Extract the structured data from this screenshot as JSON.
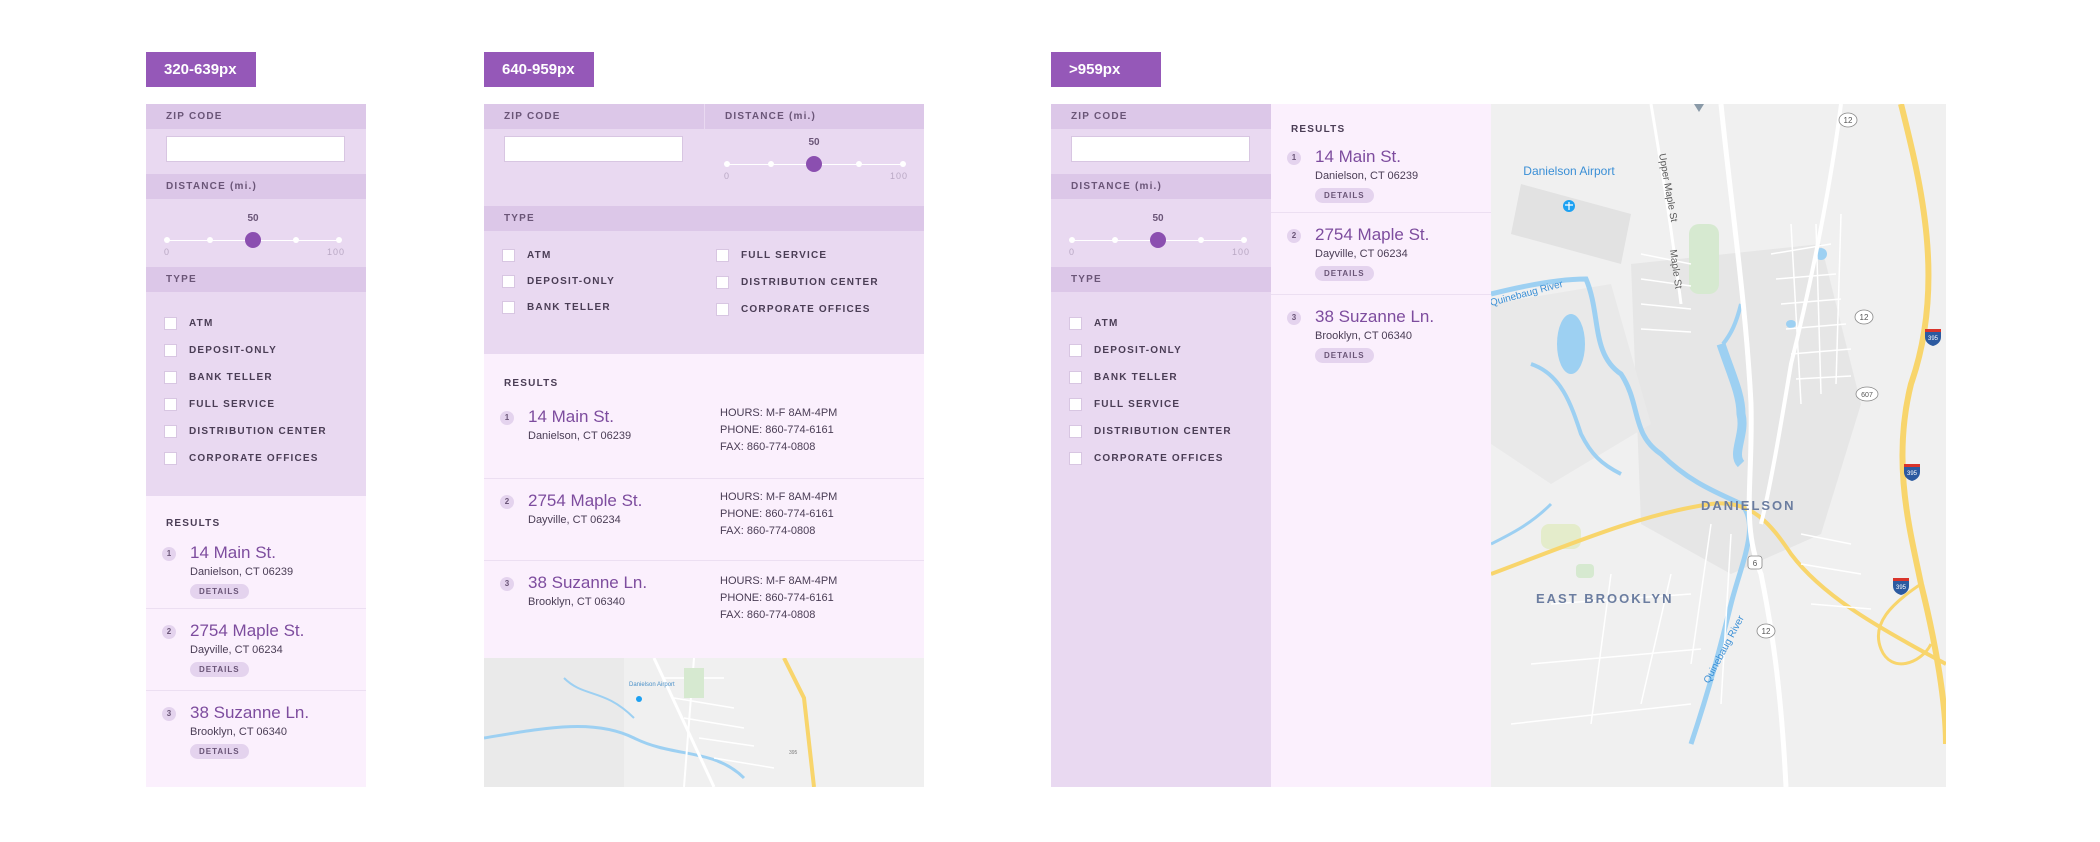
{
  "breakpoints": {
    "small": "320-639px",
    "medium": "640-959px",
    "large": ">959px"
  },
  "filters": {
    "zip_label": "ZIP CODE",
    "distance_label": "DISTANCE (mi.)",
    "distance_value": "50",
    "distance_min": "0",
    "distance_max": "100",
    "type_label": "TYPE",
    "types": [
      "ATM",
      "DEPOSIT-ONLY",
      "BANK TELLER",
      "FULL SERVICE",
      "DISTRIBUTION CENTER",
      "CORPORATE OFFICES"
    ]
  },
  "results": {
    "label": "RESULTS",
    "details_label": "DETAILS",
    "items": [
      {
        "num": "1",
        "name": "14 Main St.",
        "city": "Danielson, CT 06239",
        "hours": "HOURS: M-F 8AM-4PM",
        "phone": "PHONE: 860-774-6161",
        "fax": "FAX: 860-774-0808"
      },
      {
        "num": "2",
        "name": "2754 Maple St.",
        "city": "Dayville, CT 06234",
        "hours": "HOURS: M-F 8AM-4PM",
        "phone": "PHONE: 860-774-6161",
        "fax": "FAX: 860-774-0808"
      },
      {
        "num": "3",
        "name": "38 Suzanne Ln.",
        "city": "Brooklyn, CT 06340",
        "hours": "HOURS: M-F 8AM-4PM",
        "phone": "PHONE: 860-774-6161",
        "fax": "FAX: 860-774-0808"
      }
    ]
  },
  "map": {
    "airport": "Danielson Airport",
    "river": "Quinebaug River",
    "river_upper": "Quinebaug River",
    "upper_maple": "Upper Maple St",
    "maple": "Maple St",
    "town": "DANIELSON",
    "town2": "EAST BROOKLYN",
    "shield_12": "12",
    "shield_607": "607",
    "shield_6": "6",
    "shield_395": "395"
  },
  "colors": {
    "accent": "#9558b8",
    "filter_bg": "#e9d9f1",
    "filter_header": "#dcc7e8",
    "results_bg": "#fbf0fd",
    "map_bg": "#f0f0f0",
    "water": "#9dd0f2",
    "highway": "#f8d56c"
  }
}
